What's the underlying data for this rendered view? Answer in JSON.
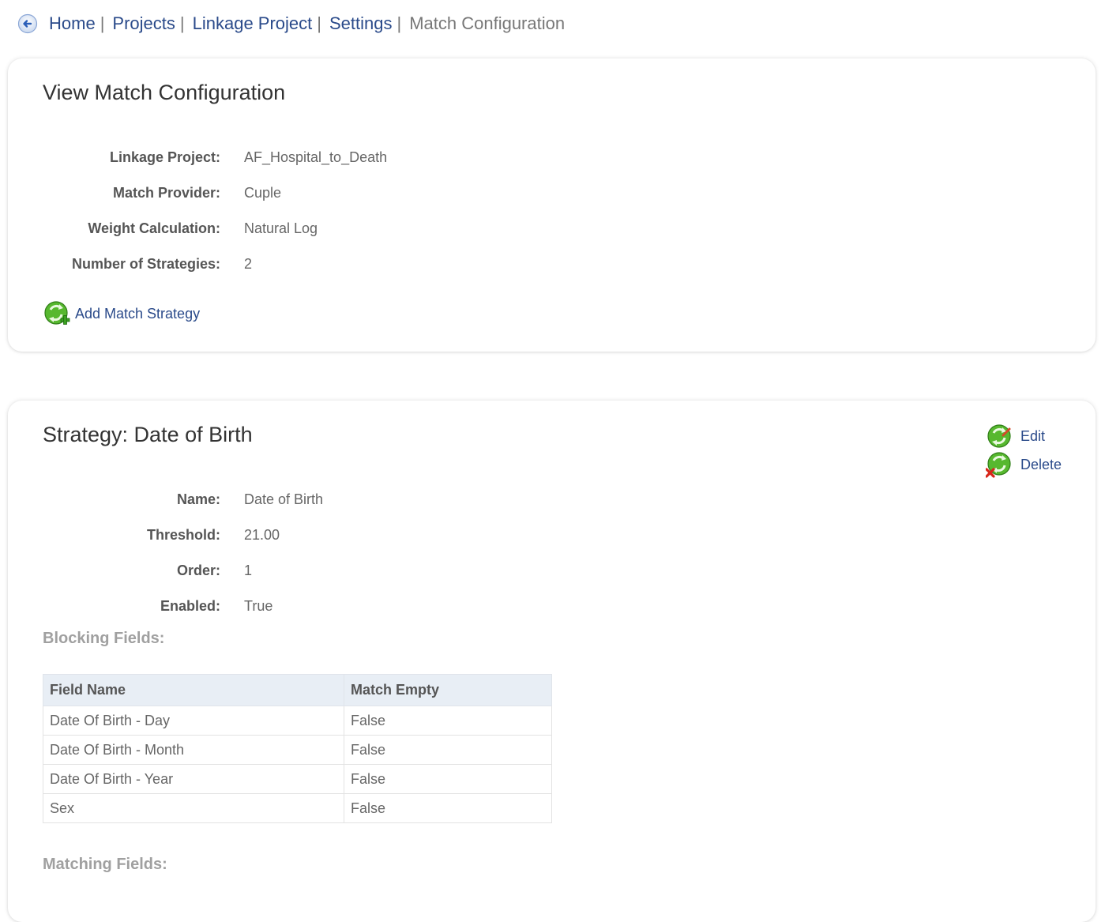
{
  "breadcrumb": {
    "back_icon": "back-arrow-circle-icon",
    "links": [
      "Home",
      "Projects",
      "Linkage Project",
      "Settings"
    ],
    "separator": "|",
    "current": "Match Configuration"
  },
  "config": {
    "title": "View Match Configuration",
    "details": [
      {
        "label": "Linkage Project:",
        "value": "AF_Hospital_to_Death"
      },
      {
        "label": "Match Provider:",
        "value": "Cuple"
      },
      {
        "label": "Weight Calculation:",
        "value": "Natural Log"
      },
      {
        "label": "Number of Strategies:",
        "value": "2"
      }
    ],
    "add_strategy_label": "Add Match Strategy",
    "add_icon": "recycle-add-icon"
  },
  "strategy": {
    "title": "Strategy: Date of Birth",
    "edit_label": "Edit",
    "delete_label": "Delete",
    "edit_icon": "recycle-edit-icon",
    "delete_icon": "recycle-delete-icon",
    "details": [
      {
        "label": "Name:",
        "value": "Date of Birth"
      },
      {
        "label": "Threshold:",
        "value": "21.00"
      },
      {
        "label": "Order:",
        "value": "1"
      },
      {
        "label": "Enabled:",
        "value": "True"
      }
    ],
    "blocking_heading": "Blocking Fields:",
    "blocking_table": {
      "headers": [
        "Field Name",
        "Match Empty"
      ],
      "rows": [
        [
          "Date Of Birth - Day",
          "False"
        ],
        [
          "Date Of Birth - Month",
          "False"
        ],
        [
          "Date Of Birth - Year",
          "False"
        ],
        [
          "Sex",
          "False"
        ]
      ]
    },
    "matching_heading": "Matching Fields:"
  },
  "colors": {
    "link": "#2a4a8a",
    "icon_green": "#4cb02c",
    "table_header_bg": "#e8eef5",
    "section_heading": "#a0a0a0"
  }
}
